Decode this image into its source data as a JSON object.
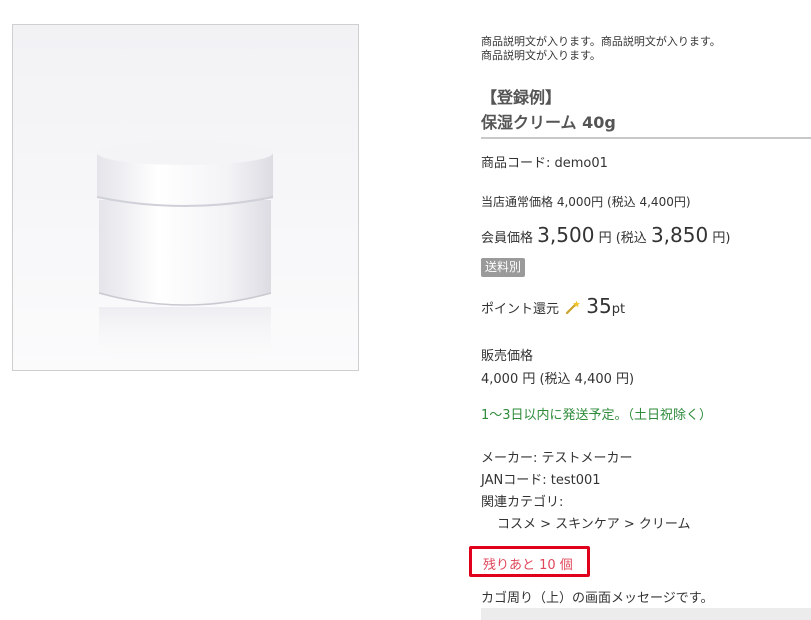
{
  "product": {
    "image_alt": "保湿クリーム",
    "description_line1": "商品説明文が入ります。商品説明文が入ります。",
    "description_line2": "商品説明文が入ります。",
    "register_example": "【登録例】",
    "name": "保湿クリーム 40g",
    "code": "商品コード: demo01",
    "normal_price": "当店通常価格 4,000円 (税込 4,400円)",
    "member_label": "会員価格",
    "member_price": "3,500",
    "member_unit": "円",
    "member_tax_prefix": "(税込",
    "member_tax_price": "3,850",
    "member_tax_suffix": "円)",
    "shipping_badge": "送料別",
    "point_label": "ポイント還元",
    "point_value": "35",
    "point_unit": "pt",
    "sale_price_label": "販売価格",
    "sale_price": "4,000 円 (税込 4,400 円)",
    "delivery": "1～3日以内に発送予定。（土日祝除く）",
    "maker": "メーカー: テストメーカー",
    "jan": "JANコード: test001",
    "category_label": "関連カテゴリ:",
    "category_path": "コスメ > スキンケア > クリーム",
    "stock": "残りあと 10 個",
    "cart_message": "カゴ周り（上）の画面メッセージです。"
  },
  "colors": {
    "stock_border": "#e0001b",
    "delivery_text": "#2e8b3a",
    "badge_bg": "#9a9a9a"
  },
  "icons": {
    "point": "magic-wand-icon"
  }
}
